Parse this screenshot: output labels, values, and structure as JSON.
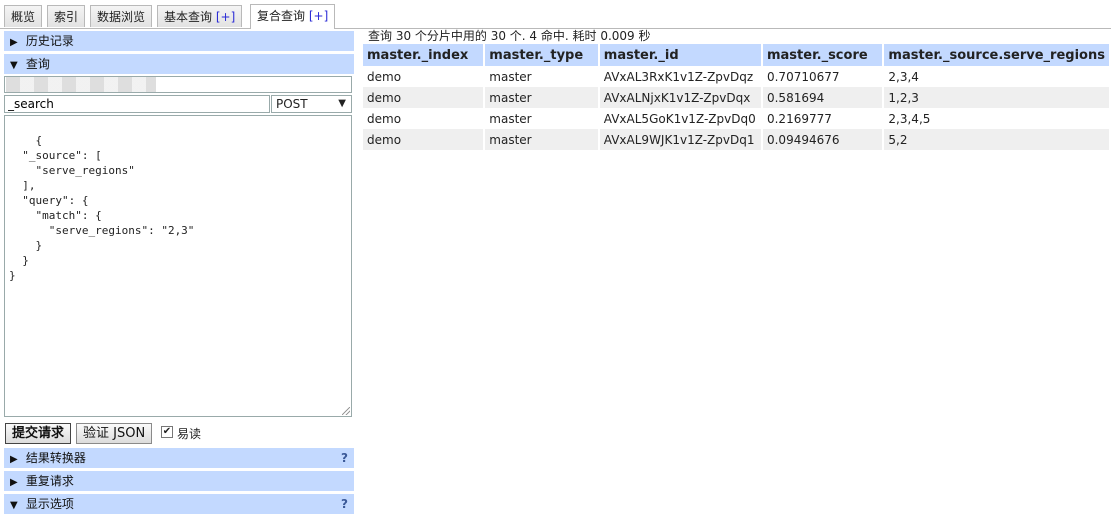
{
  "tabs": [
    {
      "label": "概览",
      "plus": ""
    },
    {
      "label": "索引",
      "plus": ""
    },
    {
      "label": "数据浏览",
      "plus": ""
    },
    {
      "label": "基本查询",
      "plus": "[+]"
    },
    {
      "label": "复合查询",
      "plus": "[+]"
    }
  ],
  "left": {
    "history_label": "历史记录",
    "query_label": "查询",
    "url_value": "",
    "path_value": "_search",
    "method_value": "POST",
    "body": "{\n  \"_source\": [\n    \"serve_regions\"\n  ],\n  \"query\": {\n    \"match\": {\n      \"serve_regions\": \"2,3\"\n    }\n  }\n}",
    "submit_label": "提交请求",
    "validate_label": "验证 JSON",
    "pretty_checked": "✔",
    "pretty_label": "易读",
    "transformer_label": "结果转换器",
    "repeat_label": "重复请求",
    "display_label": "显示选项",
    "help_mark": "?"
  },
  "results": {
    "status": "查询 30 个分片中用的 30 个. 4 命中. 耗时 0.009 秒",
    "columns": [
      "master._index",
      "master._type",
      "master._id",
      "master._score",
      "master._source.serve_regions"
    ],
    "rows": [
      [
        "demo",
        "master",
        "AVxAL3RxK1v1Z-ZpvDqz",
        "0.70710677",
        "2,3,4"
      ],
      [
        "demo",
        "master",
        "AVxALNjxK1v1Z-ZpvDqx",
        "0.581694",
        "1,2,3"
      ],
      [
        "demo",
        "master",
        "AVxAL5GoK1v1Z-ZpvDq0",
        "0.2169777",
        "2,3,4,5"
      ],
      [
        "demo",
        "master",
        "AVxAL9WJK1v1Z-ZpvDq1",
        "0.09494676",
        "5,2"
      ]
    ]
  },
  "colors": {
    "header_bg": "#c3d9ff",
    "alt_row": "#efefef",
    "plus": "#2b2bd6"
  },
  "icons": {
    "collapsed": "triangle-right-icon",
    "expanded": "triangle-down-icon",
    "help": "help-icon"
  }
}
